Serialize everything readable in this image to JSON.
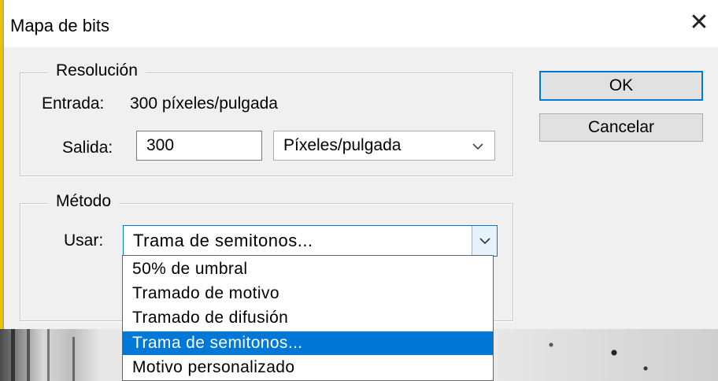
{
  "dialog": {
    "title": "Mapa de bits",
    "close_glyph": "✕"
  },
  "resolution": {
    "legend": "Resolución",
    "input_label": "Entrada:",
    "input_value": "300 píxeles/pulgada",
    "output_label": "Salida:",
    "output_value": "300",
    "unit_selected": "Píxeles/pulgada",
    "unit_icon": "chevron-down-icon"
  },
  "method": {
    "legend": "Método",
    "use_label": "Usar:",
    "selected": "Trama de semitonos...",
    "options": [
      "50% de umbral",
      "Tramado de motivo",
      "Tramado de difusión",
      "Trama de semitonos...",
      "Motivo personalizado"
    ],
    "highlighted_index": 3
  },
  "buttons": {
    "ok": "OK",
    "cancel": "Cancelar"
  },
  "colors": {
    "accent": "#0078d7",
    "dialog_bg": "#f0f0f0",
    "window_edge": "#e5c100"
  }
}
